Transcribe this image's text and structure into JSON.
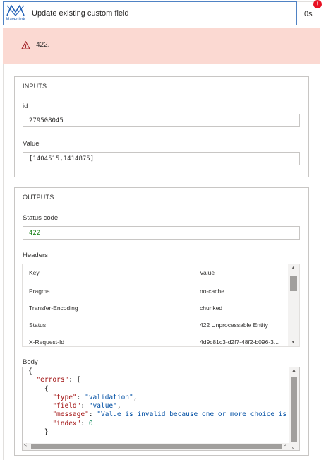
{
  "action": {
    "title": "Update existing custom field",
    "duration": "0s",
    "badge": "!",
    "logo_text": "Mavenlink",
    "error_message": "422."
  },
  "inputs": {
    "section_title": "INPUTS",
    "fields": [
      {
        "label": "id",
        "value": "279508045"
      },
      {
        "label": "Value",
        "value": "[1404515,1414875]"
      }
    ]
  },
  "outputs": {
    "section_title": "OUTPUTS",
    "status_label": "Status code",
    "status_value": "422",
    "headers_label": "Headers",
    "headers_table": {
      "columns": [
        "Key",
        "Value"
      ],
      "rows": [
        {
          "key": "Pragma",
          "value": "no-cache"
        },
        {
          "key": "Transfer-Encoding",
          "value": "chunked"
        },
        {
          "key": "Status",
          "value": "422 Unprocessable Entity"
        },
        {
          "key": "X-Request-Id",
          "value": "4d9c81c3-d2f7-48f2-b096-3..."
        }
      ]
    },
    "body_label": "Body",
    "body_lines": [
      "{",
      "  \"errors\": [",
      "    {",
      "      \"type\": \"validation\",",
      "      \"field\": \"value\",",
      "      \"message\": \"Value is invalid because one or more choice is",
      "      \"index\": 0",
      "    }"
    ]
  },
  "colors": {
    "error_bg": "#fbd9d2",
    "status_green": "#107c10",
    "badge_red": "#e81123",
    "brand_blue": "#2563b7"
  }
}
